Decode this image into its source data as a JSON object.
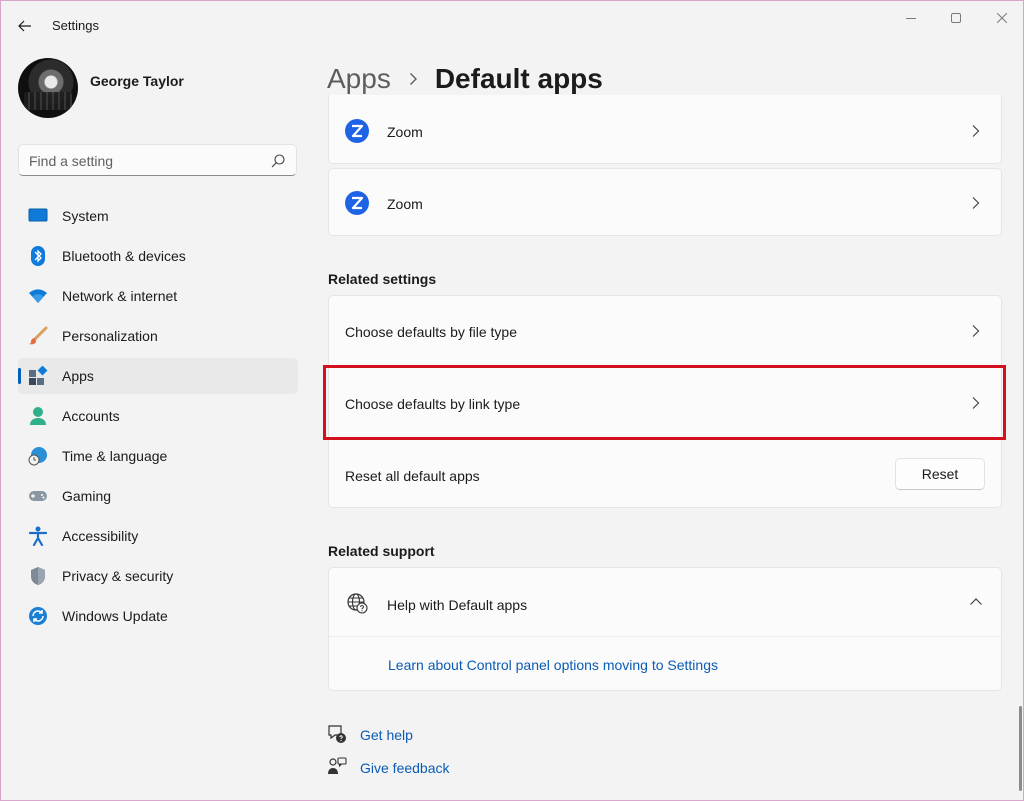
{
  "window": {
    "title": "Settings"
  },
  "profile": {
    "name": "George Taylor"
  },
  "search": {
    "placeholder": "Find a setting"
  },
  "sidebar": {
    "items": [
      {
        "label": "System",
        "icon": "monitor-icon"
      },
      {
        "label": "Bluetooth & devices",
        "icon": "bluetooth-icon"
      },
      {
        "label": "Network & internet",
        "icon": "wifi-icon"
      },
      {
        "label": "Personalization",
        "icon": "brush-icon"
      },
      {
        "label": "Apps",
        "icon": "apps-icon",
        "active": true
      },
      {
        "label": "Accounts",
        "icon": "person-icon"
      },
      {
        "label": "Time & language",
        "icon": "globe-clock-icon"
      },
      {
        "label": "Gaming",
        "icon": "gamepad-icon"
      },
      {
        "label": "Accessibility",
        "icon": "accessibility-icon"
      },
      {
        "label": "Privacy & security",
        "icon": "shield-icon"
      },
      {
        "label": "Windows Update",
        "icon": "update-icon"
      }
    ]
  },
  "breadcrumb": {
    "parent": "Apps",
    "current": "Default apps"
  },
  "apps_list": [
    {
      "name": "Zoom",
      "icon": "zoom-icon"
    },
    {
      "name": "Zoom",
      "icon": "zoom-icon"
    }
  ],
  "related_settings": {
    "title": "Related settings",
    "file_type": "Choose defaults by file type",
    "link_type": "Choose defaults by link type",
    "reset_label": "Reset all default apps",
    "reset_button": "Reset"
  },
  "related_support": {
    "title": "Related support",
    "help_title": "Help with Default apps",
    "link": "Learn about Control panel options moving to Settings"
  },
  "footer": {
    "get_help": "Get help",
    "give_feedback": "Give feedback"
  },
  "colors": {
    "accent": "#005fb8",
    "highlight": "#d3111c",
    "link": "#0a5bb5",
    "zoom": "#1e63e6"
  }
}
